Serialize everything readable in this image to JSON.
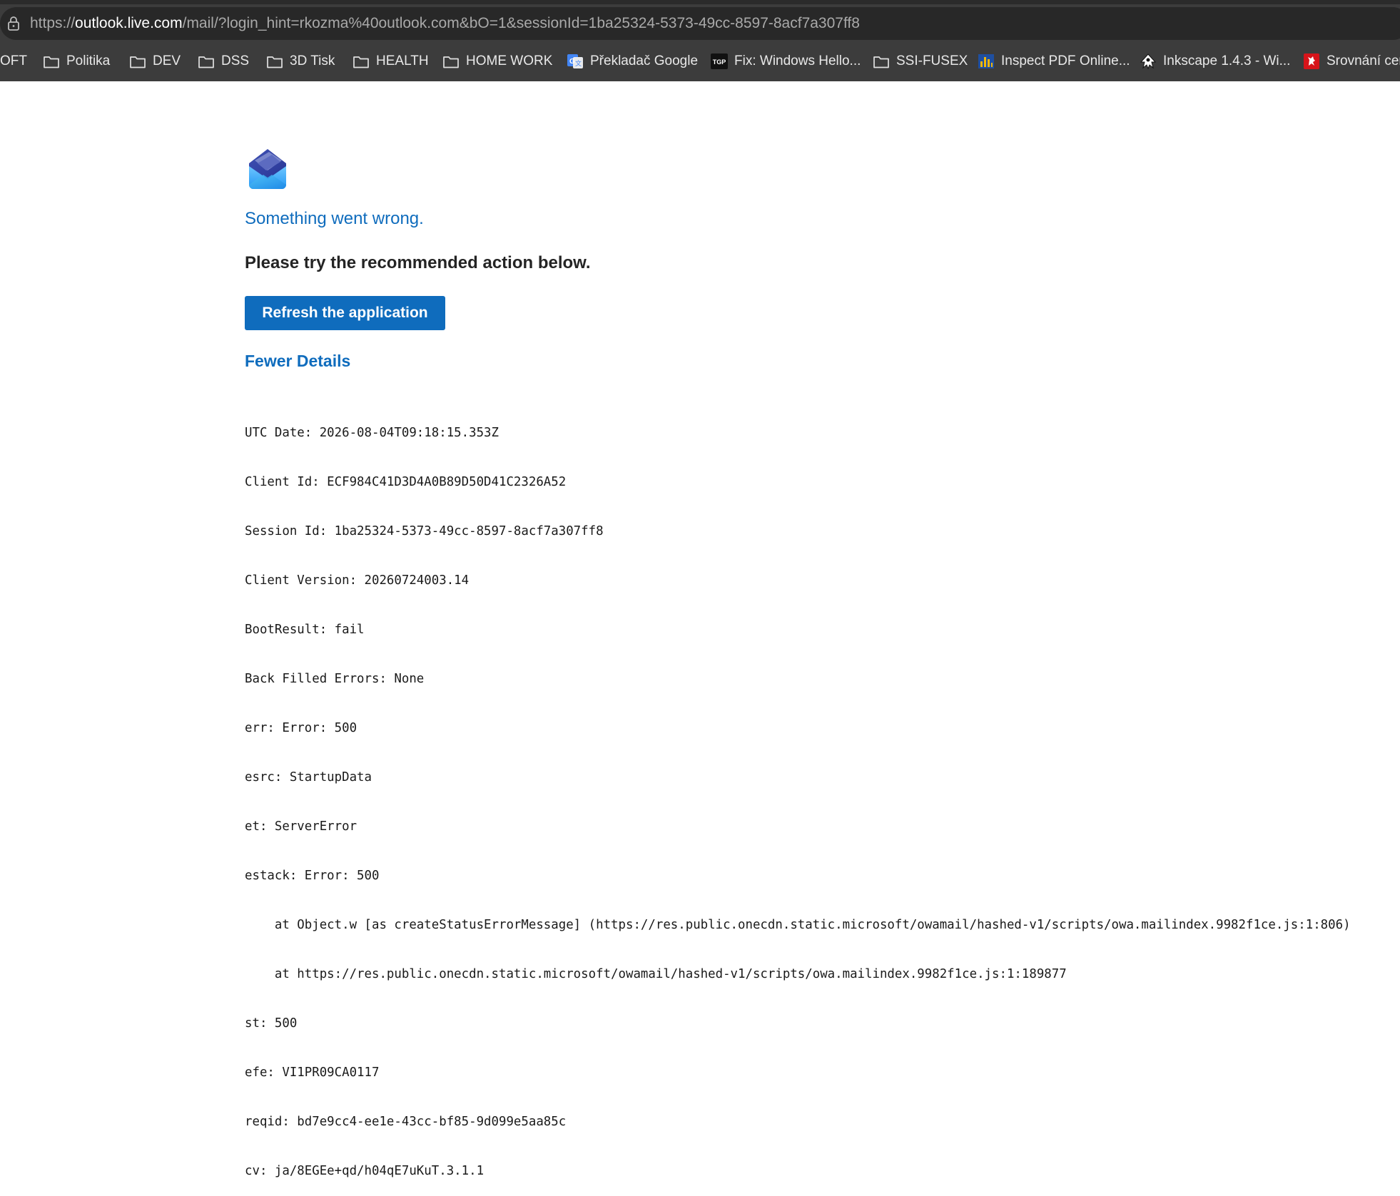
{
  "browser": {
    "url_prefix": "https://",
    "url_host": "outlook.live.com",
    "url_rest": "/mail/?login_hint=rkozma%40outlook.com&bO=1&sessionId=1ba25324-5373-49cc-8597-8acf7a307ff8",
    "bookmarks": [
      {
        "label": "OFT",
        "icon": "none"
      },
      {
        "label": "Politika",
        "icon": "folder-icon"
      },
      {
        "label": "DEV",
        "icon": "folder-icon"
      },
      {
        "label": "DSS",
        "icon": "folder-icon"
      },
      {
        "label": "3D Tisk",
        "icon": "folder-icon"
      },
      {
        "label": "HEALTH",
        "icon": "folder-icon"
      },
      {
        "label": "HOME WORK",
        "icon": "folder-icon"
      },
      {
        "label": "Překladač Google",
        "icon": "google-translate-icon"
      },
      {
        "label": "Fix: Windows Hello...",
        "icon": "tgp-icon",
        "icon_text": "TGP"
      },
      {
        "label": "SSI-FUSEX",
        "icon": "folder-icon"
      },
      {
        "label": "Inspect PDF Online...",
        "icon": "bar-chart-icon"
      },
      {
        "label": "Inkscape 1.4.3 - Wi...",
        "icon": "inkscape-icon"
      },
      {
        "label": "Srovnání cen",
        "icon": "czech-lion-icon"
      }
    ]
  },
  "page": {
    "error_title": "Something went wrong.",
    "error_subtitle": "Please try the recommended action below.",
    "refresh_label": "Refresh the application",
    "details_toggle": "Fewer Details",
    "details_lines": [
      "UTC Date: 2026-08-04T09:18:15.353Z",
      "Client Id: ECF984C41D3D4A0B89D50D41C2326A52",
      "Session Id: 1ba25324-5373-49cc-8597-8acf7a307ff8",
      "Client Version: 20260724003.14",
      "BootResult: fail",
      "Back Filled Errors: None",
      "err: Error: 500",
      "esrc: StartupData",
      "et: ServerError",
      "estack: Error: 500",
      "    at Object.w [as createStatusErrorMessage] (https://res.public.onecdn.static.microsoft/owamail/hashed-v1/scripts/owa.mailindex.9982f1ce.js:1:806)",
      "    at https://res.public.onecdn.static.microsoft/owamail/hashed-v1/scripts/owa.mailindex.9982f1ce.js:1:189877",
      "st: 500",
      "efe: VI1PR09CA0117",
      "reqid: bd7e9cc4-ee1e-43cc-bf85-9d099e5aa85c",
      "cv: ja/8EGEe+qd/h04qE7uKuT.3.1.1"
    ]
  },
  "colors": {
    "accent": "#0f6cbd",
    "chrome_bg": "#3c3c3c",
    "address_bg": "#282828"
  }
}
